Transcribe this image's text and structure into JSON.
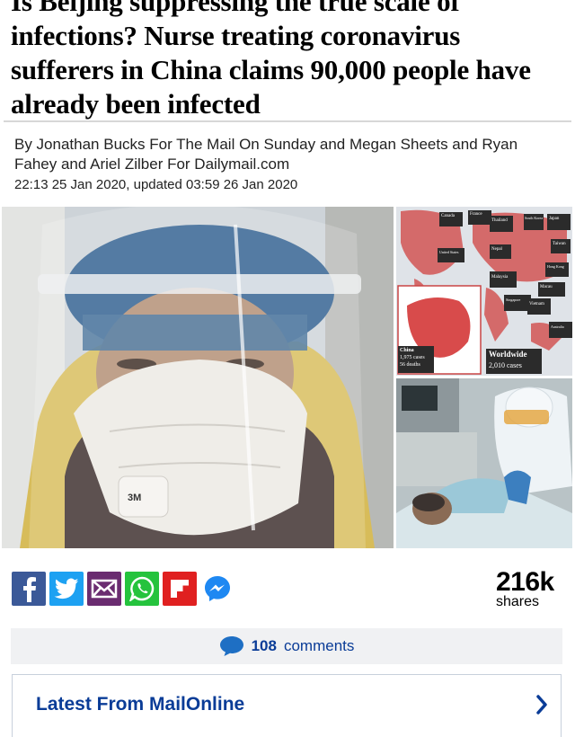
{
  "article": {
    "headline": "Is Beijing suppressing the true scale of infections? Nurse treating coronavirus sufferers in China claims 90,000 people have already been infected",
    "byline": "By Jonathan Bucks For The Mail On Sunday and Megan Sheets and Ryan Fahey and Ariel Zilber For Dailymail.com",
    "dateline": "22:13 25 Jan 2020, updated 03:59 26 Jan 2020"
  },
  "images": {
    "main_mask_text": "3M",
    "map": {
      "canada": "Canada",
      "france": "France",
      "thailand": "Thailand",
      "south_korea": "South Korea",
      "japan": "Japan",
      "united_states": "United States",
      "nepal": "Nepal",
      "taiwan": "Taiwan",
      "hong_kong": "Hong Kong",
      "malaysia": "Malaysia",
      "macau": "Macau",
      "singapore": "Singapore",
      "vietnam": "Vietnam",
      "australia": "Australia",
      "china_label": "China",
      "china_cases": "1,975 cases",
      "china_deaths": "56 deaths",
      "worldwide_label": "Worldwide",
      "worldwide_cases": "2,010 cases"
    }
  },
  "share": {
    "count": "216k",
    "label": "shares",
    "buttons": [
      "facebook",
      "twitter",
      "email",
      "whatsapp",
      "flipboard",
      "messenger"
    ]
  },
  "comments": {
    "count": "108",
    "label": "comments"
  },
  "latest": {
    "title": "Latest From MailOnline"
  },
  "colors": {
    "link_blue": "#0a3c97",
    "facebook": "#3b5998",
    "twitter": "#1da1f2",
    "email": "#6a2c70",
    "whatsapp": "#25c33d",
    "flipboard": "#e02020"
  }
}
